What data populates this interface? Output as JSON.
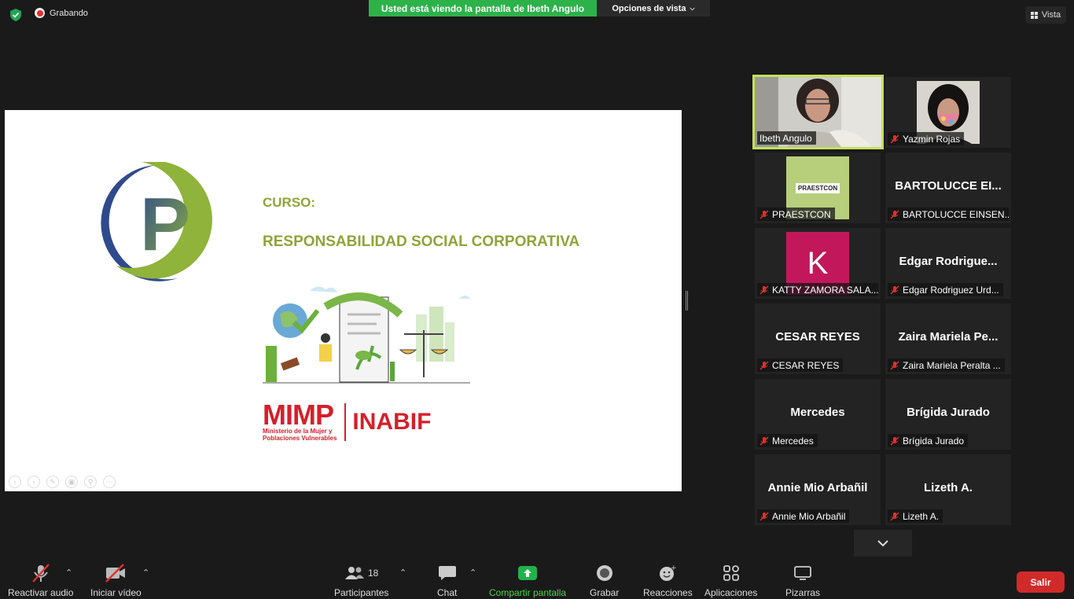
{
  "topbar": {
    "recording_label": "Grabando",
    "banner_text": "Usted está viendo la pantalla de Ibeth Angulo",
    "view_options_label": "Opciones de vista",
    "view_label": "Vista"
  },
  "slide": {
    "course_label": "CURSO:",
    "course_title": "RESPONSABILIDAD SOCIAL CORPORATIVA",
    "logo_letter": "P",
    "mimp_name": "MIMP",
    "mimp_subtitle_1": "Ministerio de la Mujer y",
    "mimp_subtitle_2": "Poblaciones Vulnerables",
    "inabif_name": "INABIF"
  },
  "gallery": {
    "tiles": [
      {
        "display": "video",
        "name": "Ibeth Angulo",
        "muted": false,
        "active": true
      },
      {
        "display": "video",
        "name": "Yazmin Rojas",
        "muted": true
      },
      {
        "display": "logo",
        "name": "PRAESTCON",
        "logo_text": "PRAESTCON",
        "muted": true
      },
      {
        "display": "text",
        "big": "BARTOLUCCE EI...",
        "name": "BARTOLUCCE EINSEN...",
        "muted": true
      },
      {
        "display": "avatar",
        "avatar_letter": "K",
        "name": "KATTY ZAMORA SALA...",
        "muted": true
      },
      {
        "display": "text",
        "big": "Edgar  Rodrigue...",
        "name": "Edgar Rodriguez Urd...",
        "muted": true
      },
      {
        "display": "text",
        "big": "CESAR REYES",
        "name": "CESAR REYES",
        "muted": true
      },
      {
        "display": "text",
        "big": "Zaira  Mariela  Pe...",
        "name": "Zaira Mariela Peralta ...",
        "muted": true
      },
      {
        "display": "text",
        "big": "Mercedes",
        "name": "Mercedes",
        "muted": true
      },
      {
        "display": "text",
        "big": "Brígida Jurado",
        "name": "Brígida Jurado",
        "muted": true
      },
      {
        "display": "text",
        "big": "Annie Mio Arbañil",
        "name": "Annie Mio Arbañil",
        "muted": true
      },
      {
        "display": "text",
        "big": "Lizeth A.",
        "name": "Lizeth A.",
        "muted": true
      }
    ]
  },
  "toolbar": {
    "unmute_label": "Reactivar audio",
    "start_video_label": "Iniciar vídeo",
    "participants_label": "Participantes",
    "participants_count": "18",
    "chat_label": "Chat",
    "share_label": "Compartir pantalla",
    "record_label": "Grabar",
    "reactions_label": "Reacciones",
    "apps_label": "Aplicaciones",
    "whiteboards_label": "Pizarras",
    "leave_label": "Salir"
  },
  "colors": {
    "banner": "#2db24a",
    "slide_green": "#8fa33a",
    "mimp_red": "#d4202c",
    "leave_red": "#d12a2a",
    "active_border": "#c4e05c",
    "share_green": "#22b14c"
  }
}
